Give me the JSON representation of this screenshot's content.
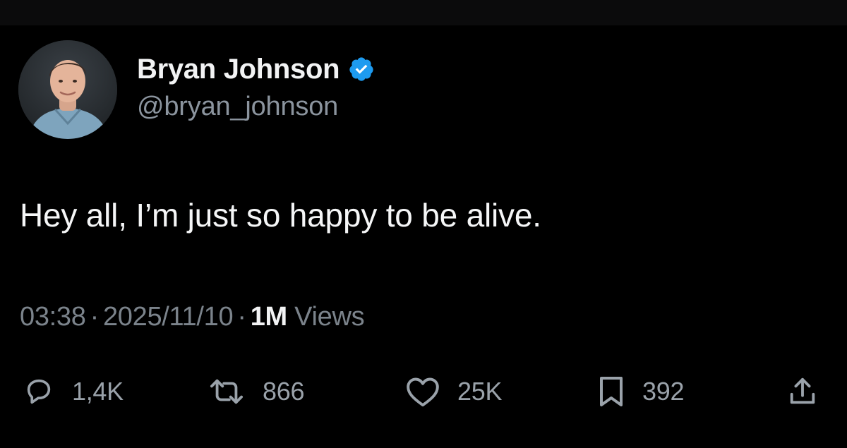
{
  "author": {
    "display_name": "Bryan Johnson",
    "handle": "@bryan_johnson",
    "verified": true,
    "avatar_icon": "avatar-photo"
  },
  "tweet": {
    "text": "Hey all, I’m just so happy to be alive.",
    "time": "03:38",
    "date": "2025/11/10",
    "views_count": "1M",
    "views_label": "Views",
    "separator": "·"
  },
  "actions": {
    "reply": {
      "icon": "speech-bubble-icon",
      "count": "1,4K"
    },
    "repost": {
      "icon": "repost-arrows-icon",
      "count": "866"
    },
    "like": {
      "icon": "heart-icon",
      "count": "25K"
    },
    "bookmark": {
      "icon": "bookmark-icon",
      "count": "392"
    },
    "share": {
      "icon": "share-upload-icon"
    }
  },
  "colors": {
    "background": "#000000",
    "text_primary": "#f2f3f4",
    "text_secondary": "#8b949e",
    "verified_blue": "#1d9bf0"
  }
}
